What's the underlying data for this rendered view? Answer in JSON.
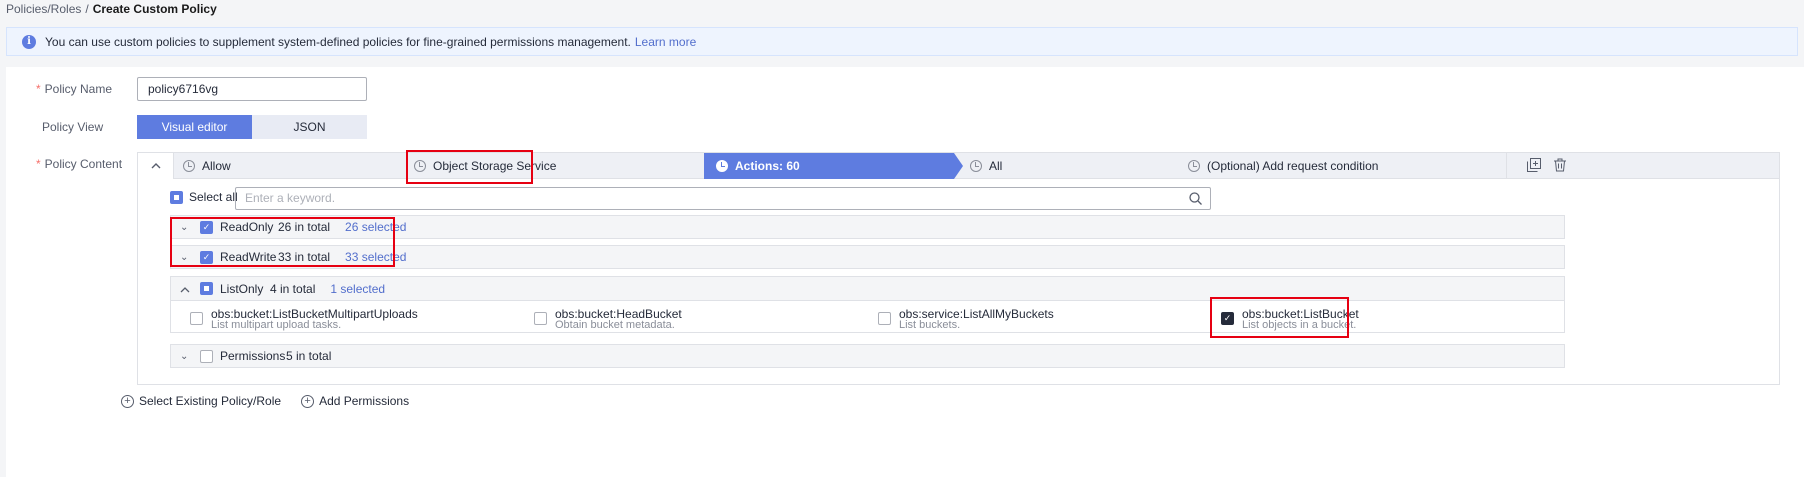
{
  "breadcrumb": {
    "parent": "Policies/Roles",
    "separator": "/",
    "current": "Create Custom Policy"
  },
  "info": {
    "icon": "info-icon",
    "text": "You can use custom policies to supplement system-defined policies for fine-grained permissions management.",
    "link": "Learn more"
  },
  "form": {
    "policy_name_label": "Policy Name",
    "policy_name_value": "policy6716vg",
    "policy_view_label": "Policy View",
    "view_options": [
      "Visual editor",
      "JSON"
    ],
    "view_selected": "Visual editor",
    "policy_content_label": "Policy Content",
    "required_mark": "*"
  },
  "steps": {
    "effect": "Allow",
    "service": "Object Storage Service",
    "actions": "Actions: 60",
    "resources": "All",
    "condition": "(Optional) Add request condition"
  },
  "select_all_label": "Select all",
  "search_placeholder": "Enter a keyword.",
  "groups": {
    "readonly": {
      "name": "ReadOnly",
      "total": "26 in total",
      "selected": "26 selected"
    },
    "readwrite": {
      "name": "ReadWrite",
      "total": "33 in total",
      "selected": "33 selected"
    },
    "listonly": {
      "name": "ListOnly",
      "total": "4 in total",
      "selected": "1 selected"
    },
    "permissions": {
      "name": "Permissions",
      "total": "5 in total"
    }
  },
  "actions": [
    {
      "name": "obs:bucket:ListBucketMultipartUploads",
      "desc": "List multipart upload tasks.",
      "checked": false
    },
    {
      "name": "obs:bucket:HeadBucket",
      "desc": "Obtain bucket metadata.",
      "checked": false
    },
    {
      "name": "obs:service:ListAllMyBuckets",
      "desc": "List buckets.",
      "checked": false
    },
    {
      "name": "obs:bucket:ListBucket",
      "desc": "List objects in a bucket.",
      "checked": true
    }
  ],
  "bottom": {
    "select_existing": "Select Existing Policy/Role",
    "add_permissions": "Add Permissions"
  },
  "colors": {
    "accent": "#5e7ce0",
    "highlight": "#e60012",
    "link": "#526ecc"
  }
}
